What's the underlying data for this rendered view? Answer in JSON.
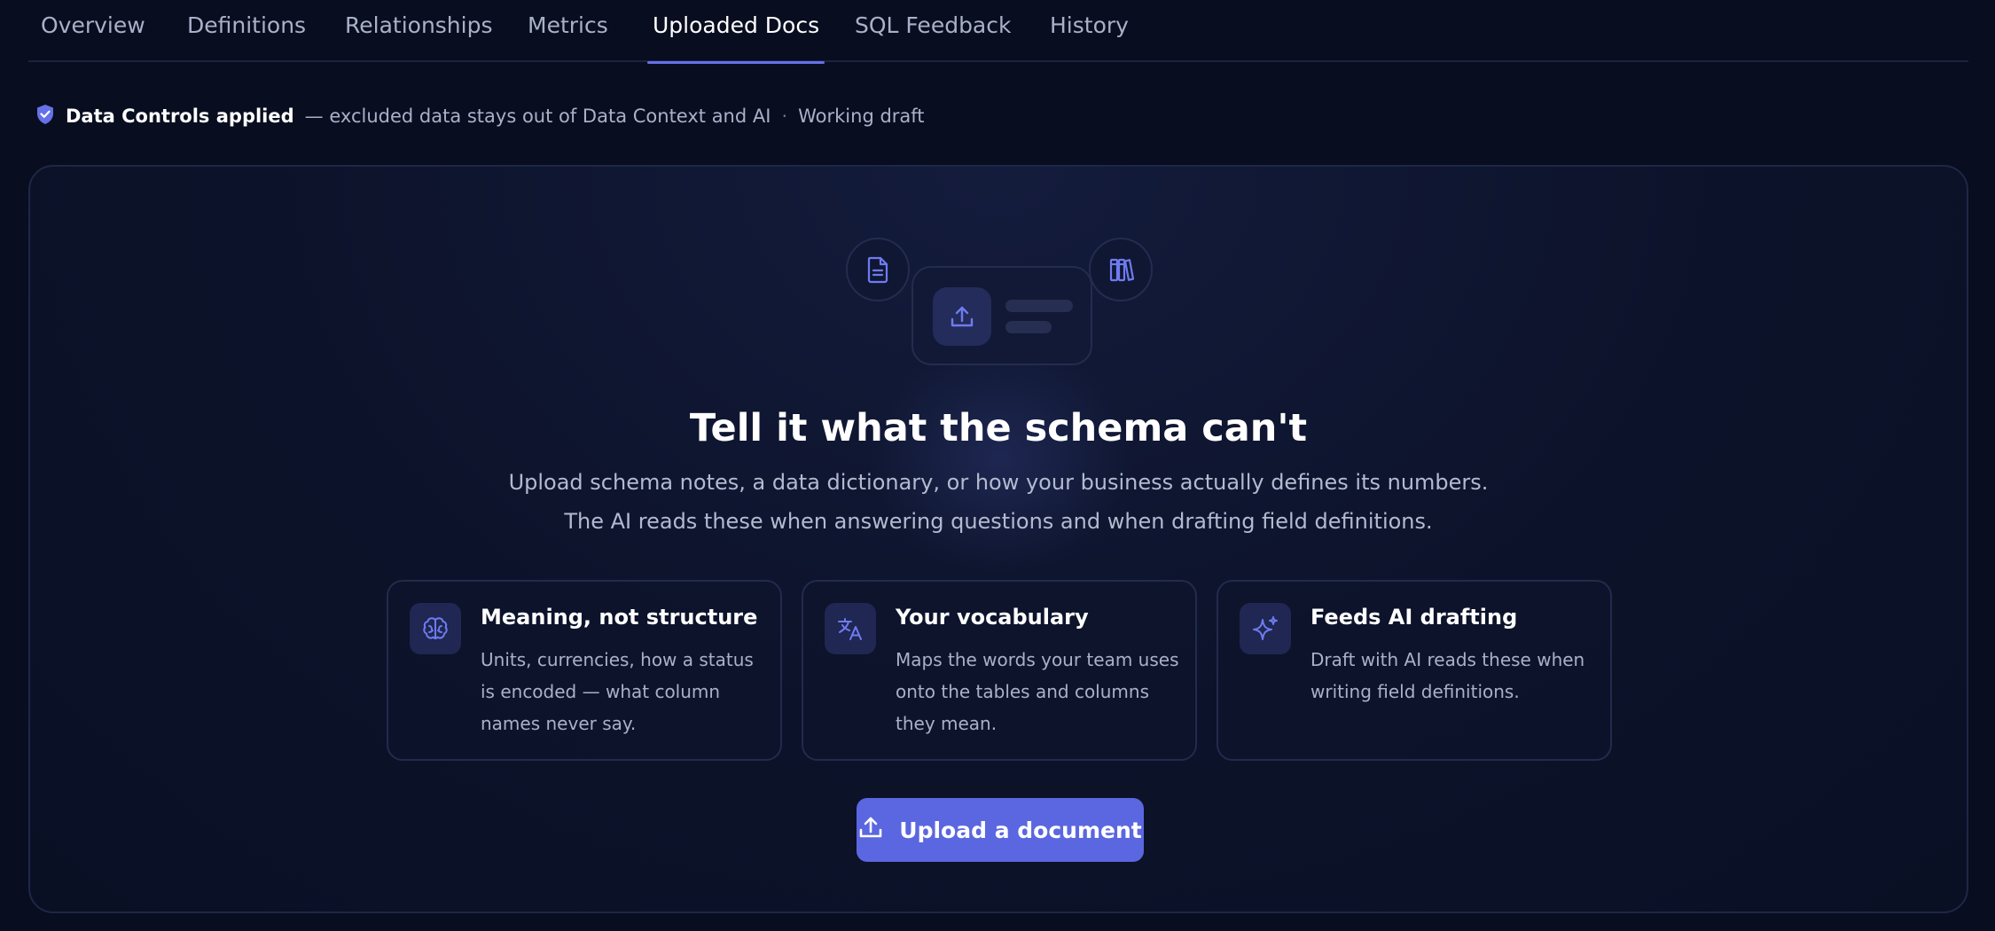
{
  "tabs": [
    {
      "label": "Overview"
    },
    {
      "label": "Definitions"
    },
    {
      "label": "Relationships"
    },
    {
      "label": "Metrics"
    },
    {
      "label": "Uploaded Docs",
      "active": true
    },
    {
      "label": "SQL Feedback"
    },
    {
      "label": "History"
    }
  ],
  "controls": {
    "icon": "shield-check-icon",
    "title": "Data Controls applied",
    "detail": "— excluded data stays out of Data Context and AI",
    "separator": "·",
    "status": "Working draft"
  },
  "hero": {
    "title": "Tell it what the schema can't",
    "line1": "Upload schema notes, a data dictionary, or how your business actually defines its numbers.",
    "line2": "The AI reads these when answering questions and when drafting field definitions."
  },
  "features": [
    {
      "icon": "brain-icon",
      "title": "Meaning, not structure",
      "desc": "Units, currencies, how a status is encoded — what column names never say."
    },
    {
      "icon": "translate-icon",
      "title": "Your vocabulary",
      "desc": "Maps the words your team uses onto the tables and columns they mean."
    },
    {
      "icon": "sparkle-icon",
      "title": "Feeds AI drafting",
      "desc": "Draft with AI reads these when writing field definitions."
    }
  ],
  "upload_button": {
    "label": "Upload a document",
    "icon": "upload-icon"
  },
  "colors": {
    "background": "#080d1f",
    "accent": "#5b67e0",
    "tab_active_underline": "#6571e8",
    "icon": "#6f7bf0"
  }
}
